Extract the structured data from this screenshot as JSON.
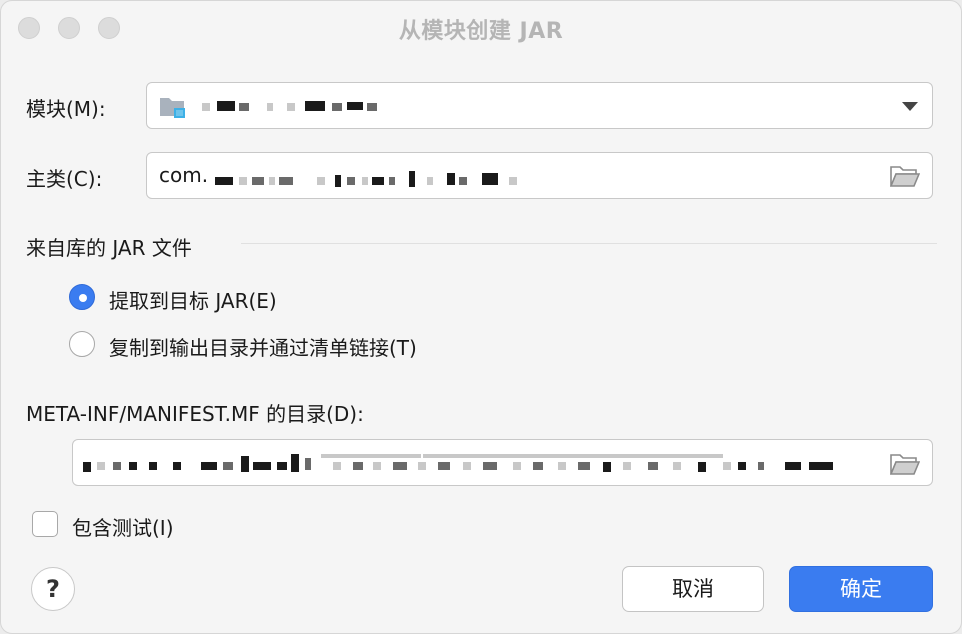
{
  "window": {
    "title": "从模块创建 JAR"
  },
  "module": {
    "label": "模块(M):"
  },
  "main_class": {
    "label": "主类(C):",
    "value_prefix": "com."
  },
  "section": {
    "title": "来自库的 JAR 文件"
  },
  "options": [
    {
      "label": "提取到目标 JAR(E)",
      "selected": true
    },
    {
      "label": "复制到输出目录并通过清单链接(T)",
      "selected": false
    }
  ],
  "manifest": {
    "label": "META-INF/MANIFEST.MF 的目录(D):"
  },
  "include_tests": {
    "label": "包含测试(I)",
    "checked": false
  },
  "buttons": {
    "help": "?",
    "cancel": "取消",
    "ok": "确定"
  },
  "colors": {
    "accent": "#3a7cf0",
    "window_bg": "#f5f5f5",
    "field_border": "#c8c8c8"
  },
  "icons": {
    "module": "module-folder-icon",
    "browse": "folder-open-icon",
    "dropdown": "chevron-down-icon"
  }
}
